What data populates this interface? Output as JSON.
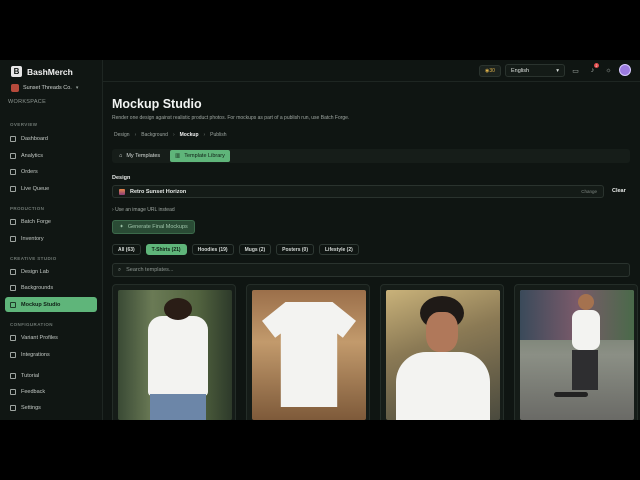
{
  "brand": {
    "name": "BashMerch",
    "logo_letter": "B"
  },
  "shop": {
    "name": "Sunset Threads Co."
  },
  "workspace_label": "WORKSPACE",
  "sidebar": {
    "sections": [
      {
        "label": "OVERVIEW",
        "items": [
          "Dashboard",
          "Analytics",
          "Orders",
          "Live Queue"
        ]
      },
      {
        "label": "PRODUCTION",
        "items": [
          "Batch Forge",
          "Inventory"
        ]
      },
      {
        "label": "CREATIVE STUDIO",
        "items": [
          "Design Lab",
          "Backgrounds",
          "Mockup Studio"
        ]
      },
      {
        "label": "CONFIGURATION",
        "items": [
          "Variant Profiles",
          "Integrations"
        ]
      },
      {
        "label": "",
        "items": [
          "Tutorial",
          "Feedback",
          "Settings"
        ]
      }
    ],
    "active_item": "Mockup Studio"
  },
  "topbar": {
    "credits": "30",
    "language": "English",
    "notification_count": "2"
  },
  "main": {
    "title": "Mockup Studio",
    "subtitle": "Render one design against realistic product photos. For mockups as part of a publish run, use Batch Forge.",
    "breadcrumbs": [
      "Design",
      "Background",
      "Mockup",
      "Publish"
    ],
    "breadcrumb_current": "Mockup",
    "tabs": [
      "My Templates",
      "Template Library"
    ],
    "active_tab": "Template Library",
    "design_label": "Design",
    "design_value": "Retro Sunset Horizon",
    "change_label": "Change",
    "clear_label": "Clear",
    "url_toggle": "Use an image URL instead",
    "generate_label": "Generate Final Mockups",
    "filters": [
      "All (63)",
      "T-Shirts (21)",
      "Hoodies (19)",
      "Mugs (2)",
      "Posters (0)",
      "Lifestyle (2)"
    ],
    "active_filter": "T-Shirts (21)",
    "search_placeholder": "Search templates..."
  },
  "colors": {
    "accent": "#5fb57a",
    "background": "#0f1512"
  }
}
